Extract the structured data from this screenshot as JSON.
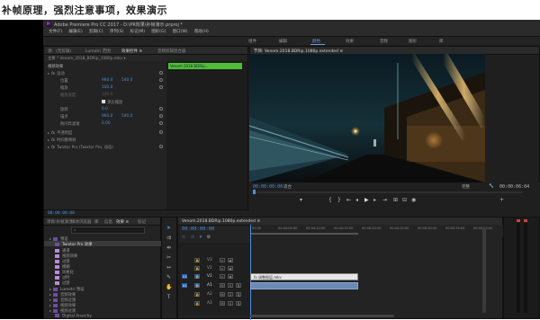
{
  "caption": "补帧原理，强烈注意事项，效果演示",
  "window": {
    "title": "Adobe Premiere Pro CC 2017 - D:\\PR效果\\补帧演示.prproj *"
  },
  "menu": [
    "文件(F)",
    "编辑(E)",
    "剪辑(C)",
    "序列(S)",
    "标记(M)",
    "图形(G)",
    "窗口(W)",
    "帮助(H)"
  ],
  "workspace_tabs": [
    "组件",
    "编辑",
    "颜色",
    "效果",
    "音频",
    "图形",
    "库"
  ],
  "source_panel": {
    "tabs": [
      "源：(无剪辑)",
      "Lumetri 范围",
      "效果控件 ≡",
      "音频剪辑混合器"
    ],
    "clip_header": "主要 * Venom_2018_BDRip_1080p.mkv ▾",
    "clip_name": "Venom 2018 BDRip...",
    "section_video": "视频效果",
    "effects": [
      {
        "label": "运动",
        "expanded": true
      },
      {
        "label": "位置",
        "value1": "960.0",
        "value2": "540.0"
      },
      {
        "label": "缩放",
        "value1": "100.0"
      },
      {
        "label": "缩放宽度",
        "value1": "100.0"
      },
      {
        "label": "等比缩放",
        "checkbox": true
      },
      {
        "label": "旋转",
        "value1": "0.0"
      },
      {
        "label": "锚点",
        "value1": "960.0",
        "value2": "540.0"
      },
      {
        "label": "防闪烁滤镜",
        "value1": "0.00"
      },
      {
        "label": "不透明度",
        "expanded": false
      },
      {
        "label": "时间重映射",
        "expanded": false
      },
      {
        "label": "Twixtor Pro (Twixtor Pro, 动态)",
        "expanded": false
      }
    ],
    "timecode": "00:00:00:00"
  },
  "program_monitor": {
    "tab": "节目: Venom.2018.BDRip.1080p.extended ≡",
    "timecode_left": "00:00:00:00",
    "fit": "适合",
    "quality": "完整",
    "timecode_right": "00:00:06:04"
  },
  "project_panel": {
    "tabs": [
      "项目:补帧演示",
      "媒体浏览器",
      "库",
      "信息",
      "效果 ≡",
      "标记"
    ],
    "items": [
      {
        "label": "预设",
        "type": "folder",
        "indent": 0
      },
      {
        "label": "Twixtor Pro 效果",
        "type": "folder",
        "indent": 1
      },
      {
        "label": "通道",
        "type": "bin",
        "indent": 1
      },
      {
        "label": "视频效果",
        "type": "bin",
        "indent": 1
      },
      {
        "label": "过渡",
        "type": "bin",
        "indent": 1
      },
      {
        "label": "模糊",
        "type": "bin",
        "indent": 1
      },
      {
        "label": "风格化",
        "type": "bin",
        "indent": 1
      },
      {
        "label": "过时",
        "type": "bin",
        "indent": 1
      },
      {
        "label": "过渡",
        "type": "bin",
        "indent": 1
      },
      {
        "label": "Lumetri 预设",
        "type": "folder",
        "indent": 0
      },
      {
        "label": "音频效果",
        "type": "folder",
        "indent": 0
      },
      {
        "label": "音频过渡",
        "type": "folder",
        "indent": 0
      },
      {
        "label": "视频效果",
        "type": "folder",
        "indent": 0
      },
      {
        "label": "视频过渡",
        "type": "folder",
        "indent": 0
      },
      {
        "label": "Digital Anarchy",
        "type": "folder",
        "indent": 0
      }
    ]
  },
  "timeline": {
    "tab": "Venom.2018.BDRip.1080p.extended ≡",
    "timecode": "00:00:00:00",
    "ruler": [
      "00:00",
      "00:00:05:00",
      "00:00:10:00",
      "00:00:15:00",
      "00:00:20:00",
      "00:00:25:00",
      "00:00:30:00",
      "00:00:35:00",
      "00:00:40:00"
    ],
    "tracks": [
      {
        "label": "V3"
      },
      {
        "label": "V2"
      },
      {
        "label": "V1"
      },
      {
        "label": "A1"
      },
      {
        "label": "A2"
      },
      {
        "label": "A3"
      }
    ],
    "clip_label": "fx 调整图层.mkv"
  },
  "colors": {
    "accent": "#4d8fe0",
    "video_clip": "#d9d9d9",
    "audio_clip": "#6b8ab8",
    "green_bar": "#4fbd38"
  }
}
